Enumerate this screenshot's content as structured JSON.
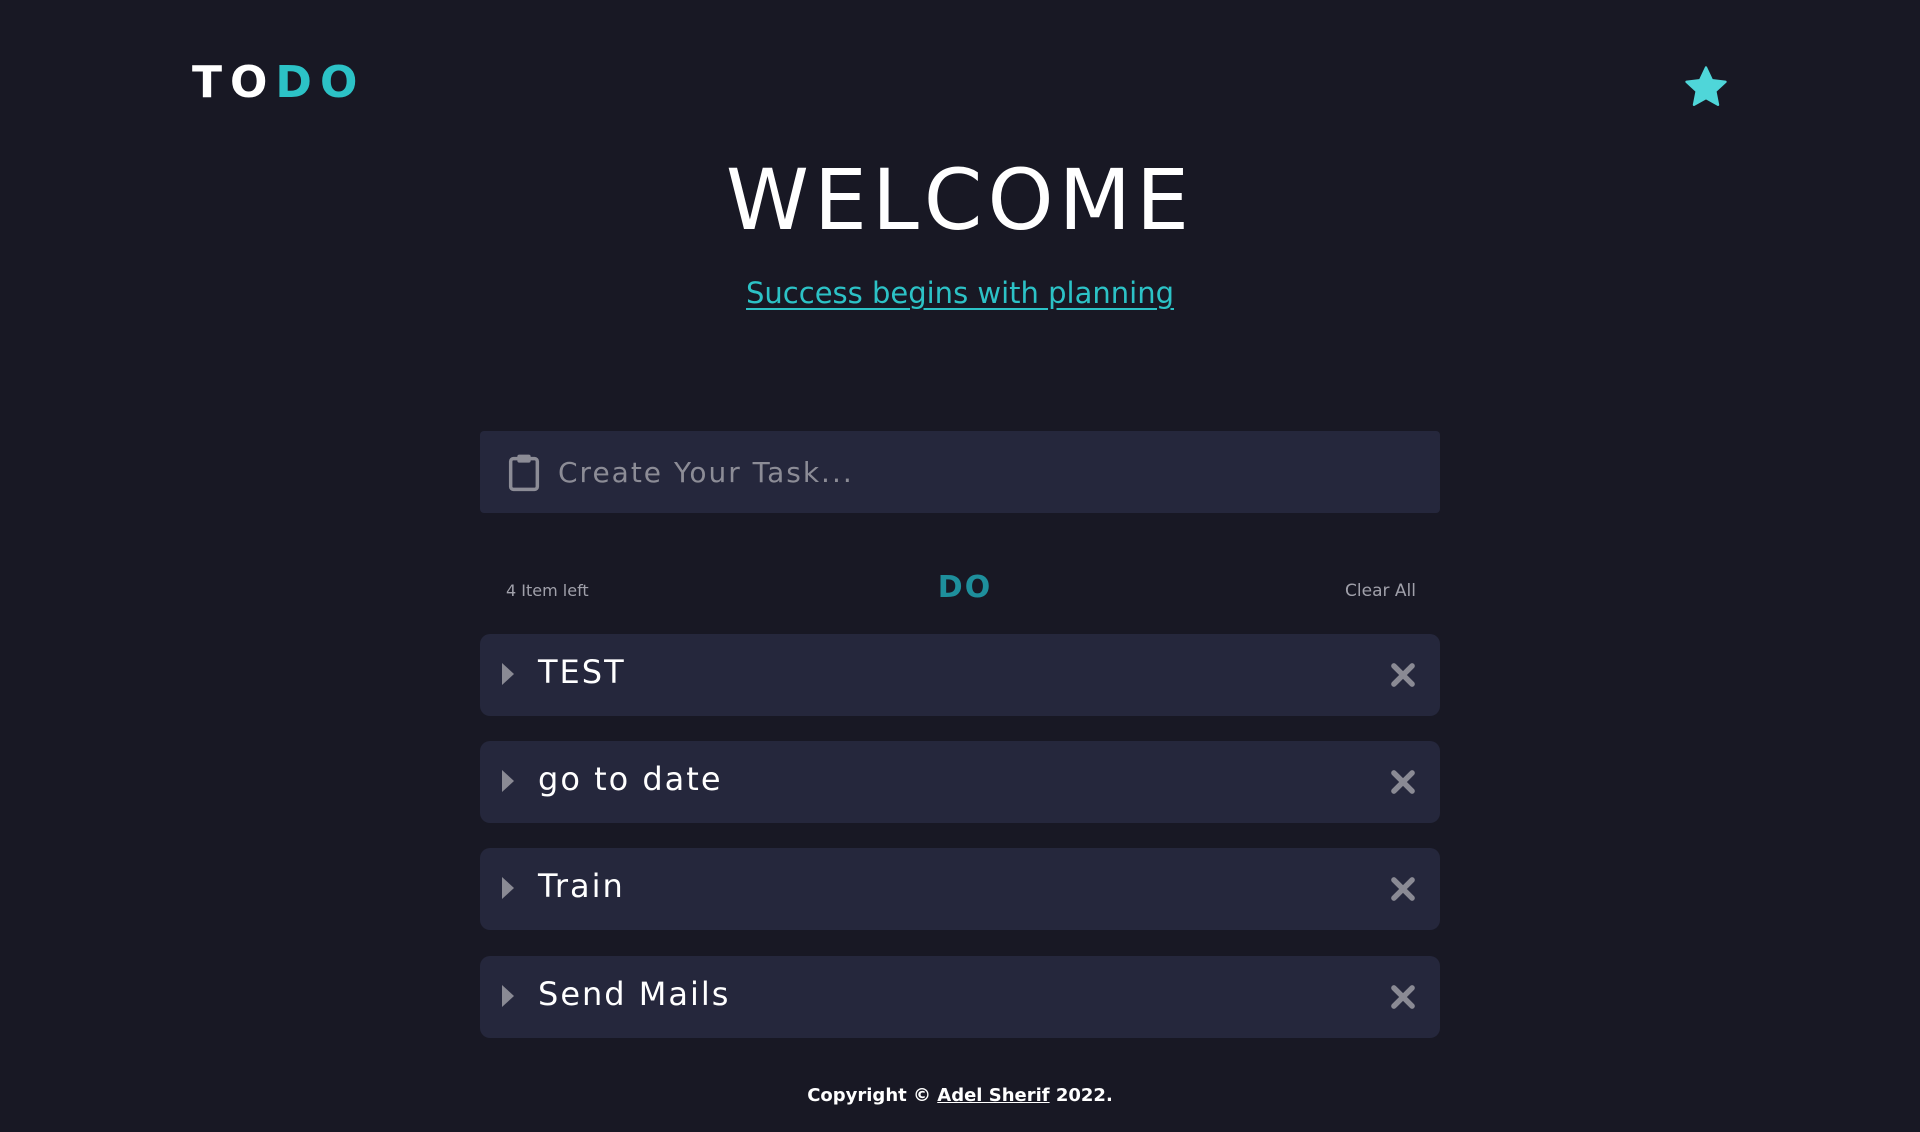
{
  "brand": {
    "logo_part1": "TO",
    "logo_part2": "DO"
  },
  "header": {
    "star_icon": "star-icon",
    "accent_color": "#2cc2c6"
  },
  "hero": {
    "title": "WELCOME",
    "tagline": "Success begins with planning"
  },
  "task_input": {
    "placeholder": "Create Your Task...",
    "value": "",
    "icon": "clipboard-icon"
  },
  "list_bar": {
    "items_left": "4 Item left",
    "filter_label": "DO",
    "clear_all": "Clear All"
  },
  "tasks": [
    {
      "label": "TEST"
    },
    {
      "label": "go to date"
    },
    {
      "label": "Train"
    },
    {
      "label": "Send Mails"
    }
  ],
  "footer": {
    "prefix": "Copyright © ",
    "author": "Adel Sherif",
    "year": " 2022."
  }
}
